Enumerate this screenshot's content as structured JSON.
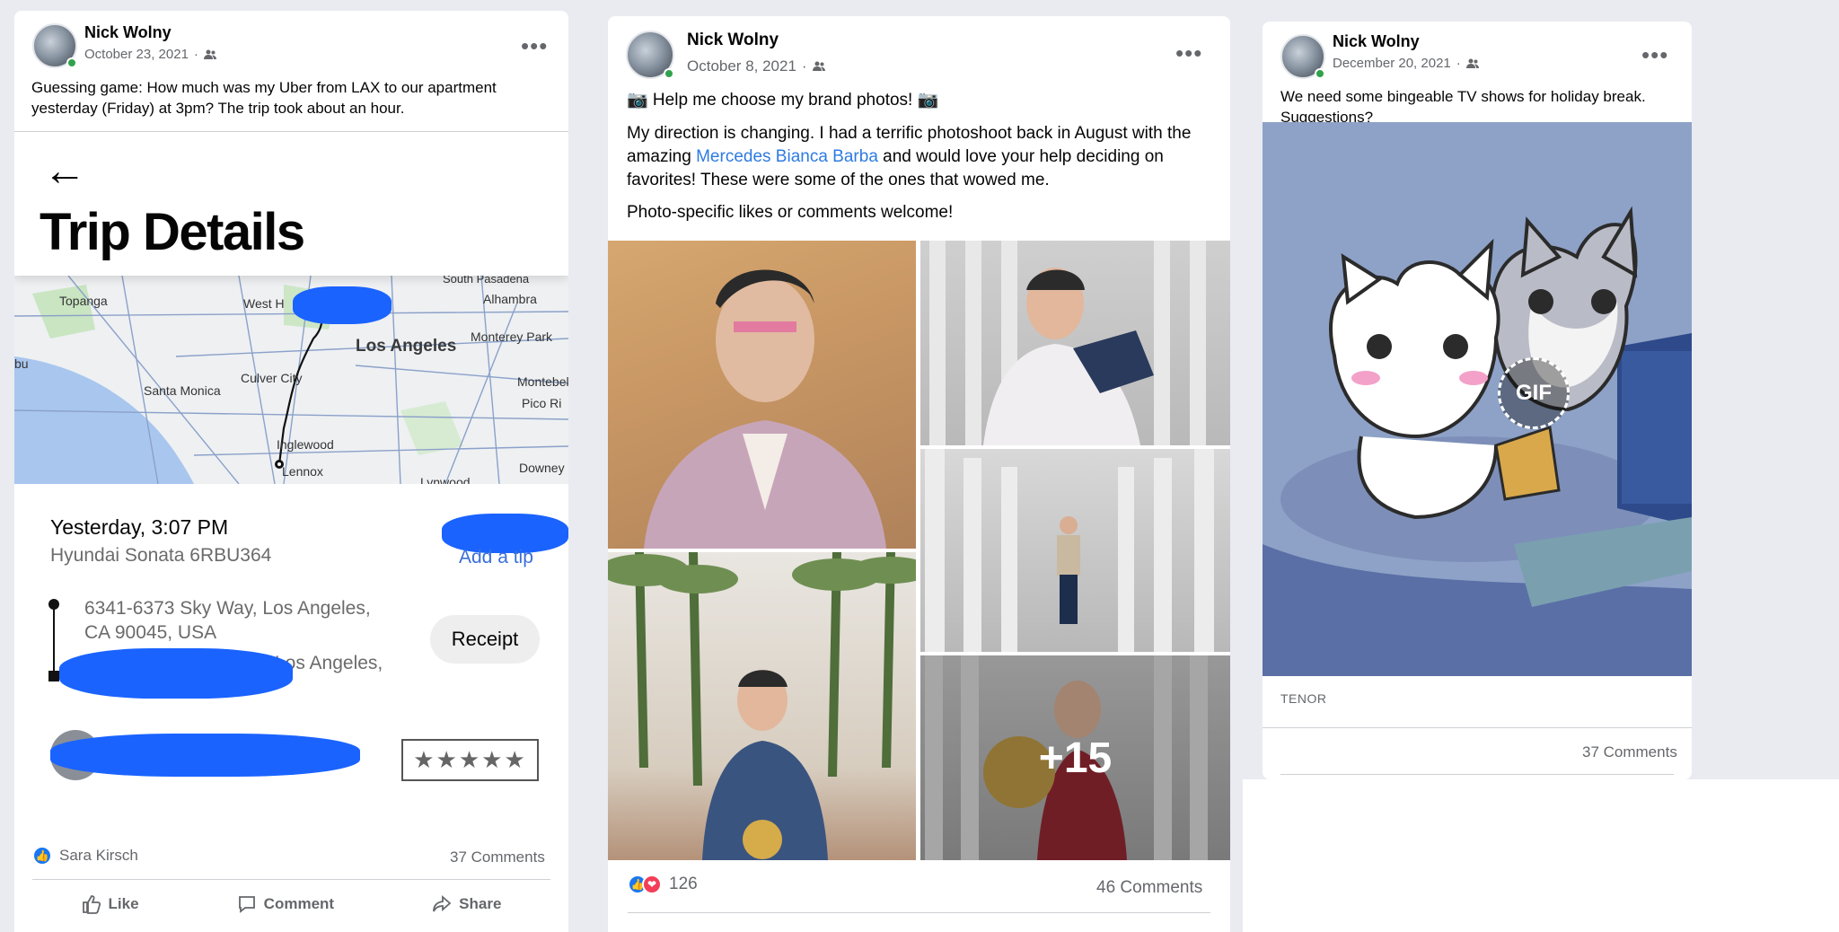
{
  "posts": [
    {
      "author": "Nick Wolny",
      "date": "October 23, 2021",
      "text": "Guessing game: How much was my Uber from LAX to our apartment yesterday (Friday) at 3pm? The trip took about an hour.",
      "screenshot": {
        "back_arrow": "←",
        "title": "Trip Details",
        "map_labels": [
          "South Pasadena",
          "Topanga",
          "West H",
          "Alhambra",
          "Los Angeles",
          "Monterey Park",
          "bu",
          "Santa Monica",
          "Culver City",
          "Montebello",
          "Pico Ri",
          "Inglewood",
          "Downey",
          "Lennox",
          "Lynwood"
        ],
        "trip_date": "Yesterday, 3:07 PM",
        "vehicle": "Hyundai Sonata 6RBU364",
        "add_tip": "Add a tip",
        "pickup_address": "6341-6373 Sky Way, Los Angeles, CA 90045, USA",
        "dropoff_partial": "Los Angeles,",
        "receipt_button": "Receipt",
        "rating_stars": "★★★★★"
      },
      "reactions_by": "Sara Kirsch",
      "comments": "37 Comments",
      "actions": [
        "Like",
        "Comment",
        "Share"
      ]
    },
    {
      "author": "Nick Wolny",
      "date": "October 8, 2021",
      "line1": "📷 Help me choose my brand photos! 📷",
      "para_start": "My direction is changing. I had a terrific photoshoot back in August with the amazing ",
      "link_text": "Mercedes Bianca Barba",
      "para_end": " and would love your help deciding on favorites! These were some of the ones that wowed me.",
      "line3": "Photo-specific likes or comments welcome!",
      "more_photos": "+15",
      "reaction_count": "126",
      "comments": "46 Comments"
    },
    {
      "author": "Nick Wolny",
      "date": "December 20, 2021",
      "text": "We need some bingeable TV shows for holiday break. Suggestions?",
      "gif_badge": "GIF",
      "gif_source": "TENOR",
      "comments": "37 Comments"
    }
  ],
  "colors": {
    "link": "#2d7be0",
    "like_blue": "#1877f2",
    "love_red": "#f33e58",
    "online_green": "#31a24c"
  }
}
